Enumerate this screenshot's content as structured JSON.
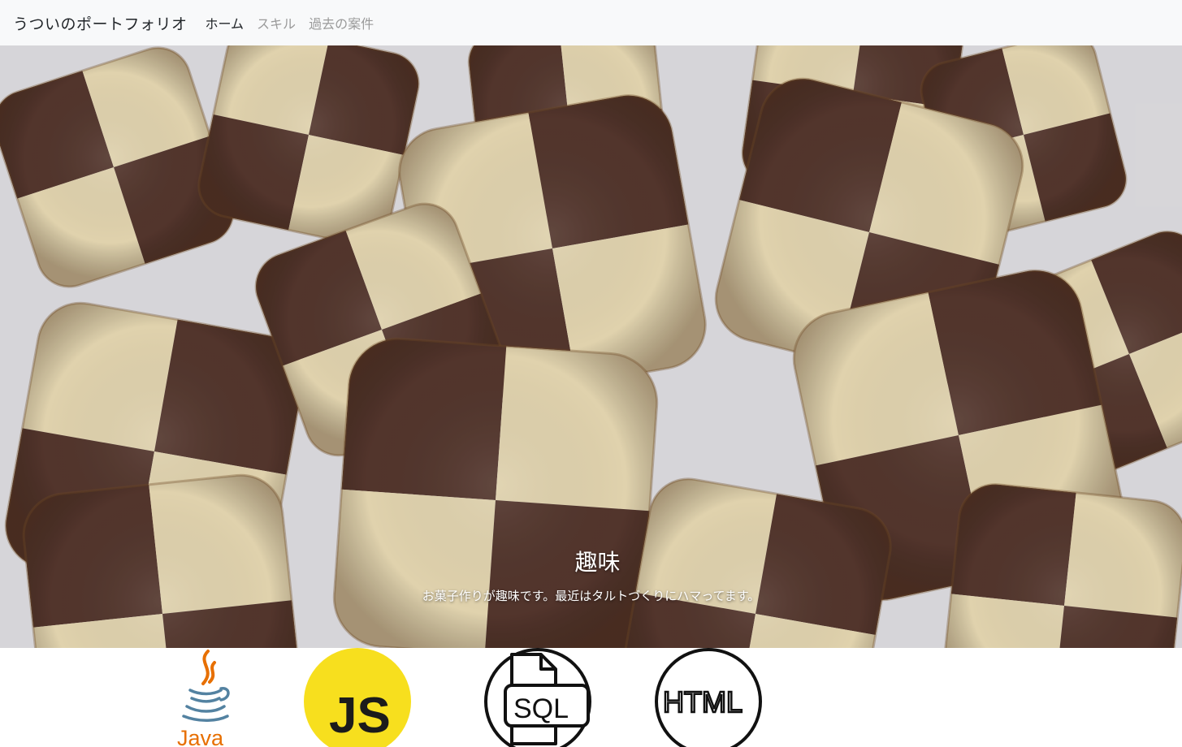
{
  "navbar": {
    "brand": "うついのポートフォリオ",
    "links": [
      {
        "label": "ホーム",
        "active": true
      },
      {
        "label": "スキル",
        "active": false
      },
      {
        "label": "過去の案件",
        "active": false
      }
    ]
  },
  "hero": {
    "image": "checkerboard-cookies-photo",
    "title": "趣味",
    "text": "お菓子作りが趣味です。最近はタルトづくりにハマってます。"
  },
  "skills": {
    "logos": [
      {
        "name": "java-logo",
        "text": "Java"
      },
      {
        "name": "javascript-logo",
        "text": "JS"
      },
      {
        "name": "sql-logo",
        "text": "SQL"
      },
      {
        "name": "html-logo",
        "text": "HTML"
      }
    ]
  },
  "colors": {
    "navbar_bg": "#f8f9fa",
    "cookie_dark": "#5a3a30",
    "cookie_light": "#f3e4bc",
    "js_yellow": "#f7df1e",
    "java_red": "#e76f00",
    "java_blue": "#5382a1"
  }
}
